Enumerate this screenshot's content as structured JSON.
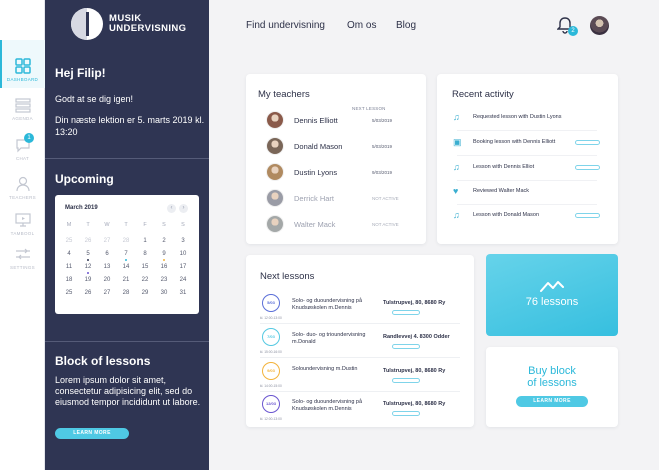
{
  "rail": {
    "items": [
      {
        "label": "DASHBOARD",
        "icon": "dashboard-grid-icon",
        "active": true
      },
      {
        "label": "AGENDA",
        "icon": "agenda-list-icon"
      },
      {
        "label": "CHAT",
        "icon": "chat-bubble-icon",
        "badge": "1"
      },
      {
        "label": "TEACHERS",
        "icon": "person-icon"
      },
      {
        "label": "TAMBOOL",
        "icon": "monitor-icon"
      },
      {
        "label": "SETTINGS",
        "icon": "settings-sliders-icon"
      }
    ]
  },
  "brand": {
    "line1": "MUSIK",
    "line2": "UNDERVISNING"
  },
  "sidebar": {
    "greeting": "Hej Filip!",
    "welcome": "Godt at se dig igen!",
    "next_lesson": "Din næste lektion er 5. marts 2019 kl. 13:20",
    "upcoming_title": "Upcoming",
    "block_title": "Block of lessons",
    "block_text": "Lorem ipsum dolor sit amet, consectetur adipisicing elit, sed do eiusmod tempor incididunt ut labore.",
    "learn_more": "LEARN MORE"
  },
  "calendar": {
    "month": "March 2019",
    "weekdays": [
      "M",
      "T",
      "W",
      "T",
      "F",
      "S",
      "S"
    ],
    "weeks": [
      [
        "25",
        "26",
        "27",
        "28",
        "1",
        "2",
        "3"
      ],
      [
        "4",
        "5",
        "6",
        "7",
        "8",
        "9",
        "10"
      ],
      [
        "11",
        "12",
        "13",
        "14",
        "15",
        "16",
        "17"
      ],
      [
        "18",
        "19",
        "20",
        "21",
        "22",
        "23",
        "24"
      ],
      [
        "25",
        "26",
        "27",
        "28",
        "29",
        "30",
        "31"
      ]
    ],
    "prev": "‹",
    "next": "›"
  },
  "topnav": {
    "links": [
      "Find undervisning",
      "Om os",
      "Blog"
    ],
    "notification_count": "2"
  },
  "teachers": {
    "title": "My teachers",
    "next_lesson_header": "NEXT LESSON",
    "rows": [
      {
        "name": "Dennis Elliott",
        "date": "5/03/2019",
        "active": true,
        "color": "#8a5a4a"
      },
      {
        "name": "Donald Mason",
        "date": "5/03/2019",
        "active": true,
        "color": "#7a6658"
      },
      {
        "name": "Dustin Lyons",
        "date": "9/03/2019",
        "active": true,
        "color": "#b08a60"
      },
      {
        "name": "Derrick Hart",
        "date": "NOT ACTIVE",
        "active": false,
        "color": "#9a9ca6"
      },
      {
        "name": "Walter Mack",
        "date": "NOT ACTIVE",
        "active": false,
        "color": "#a4a8a8"
      }
    ]
  },
  "activity": {
    "title": "Recent activity",
    "rows": [
      {
        "pre": "",
        "text": "Requested lesson with Dustin Lyons",
        "icon": "music-note-icon",
        "tag": false
      },
      {
        "pre": "",
        "text": "Booking lesson with Dennis Elliott",
        "icon": "calendar-icon",
        "tag": true
      },
      {
        "pre": "",
        "text": "Lesson with Dennis Elliot",
        "icon": "music-note-icon",
        "tag": true
      },
      {
        "pre": "",
        "text": "Reviewed Walter Mack",
        "icon": "heart-icon",
        "tag": false
      },
      {
        "pre": "",
        "text": "Lesson with Donald Mason",
        "icon": "music-note-icon",
        "tag": true
      }
    ]
  },
  "next_lessons": {
    "title": "Next lessons",
    "rows": [
      {
        "date": "5/03",
        "time": "kl. 12:00-13:00",
        "desc": "Solo- og duoundervisning på Knudsøskolen m.Dennis",
        "addr": "Tulstrupvej, 80, 8680 Ry",
        "color": "#5b6fd8"
      },
      {
        "date": "7/03",
        "time": "kl. 15:00-16:00",
        "desc": "Solo- duo- og trioundervisning m.Donald",
        "addr": "Randlevvej 4. 8300 Odder",
        "color": "#55c9e2"
      },
      {
        "date": "9/03",
        "time": "kl. 14:00-15:00",
        "desc": "Soloundervisning m.Dustin",
        "addr": "Tulstrupvej, 80, 8680 Ry",
        "color": "#f3b33b"
      },
      {
        "date": "12/03",
        "time": "kl. 12:00-13:00",
        "desc": "Solo- og duoundervisning på Knudsøskolen m.Dennis",
        "addr": "Tulstrupvej, 80, 8680 Ry",
        "color": "#6a55d0"
      }
    ]
  },
  "lessons_card": {
    "count": "76 lessons"
  },
  "buy_card": {
    "title_line1": "Buy block",
    "title_line2": "of lessons",
    "button": "LEARN MORE"
  }
}
